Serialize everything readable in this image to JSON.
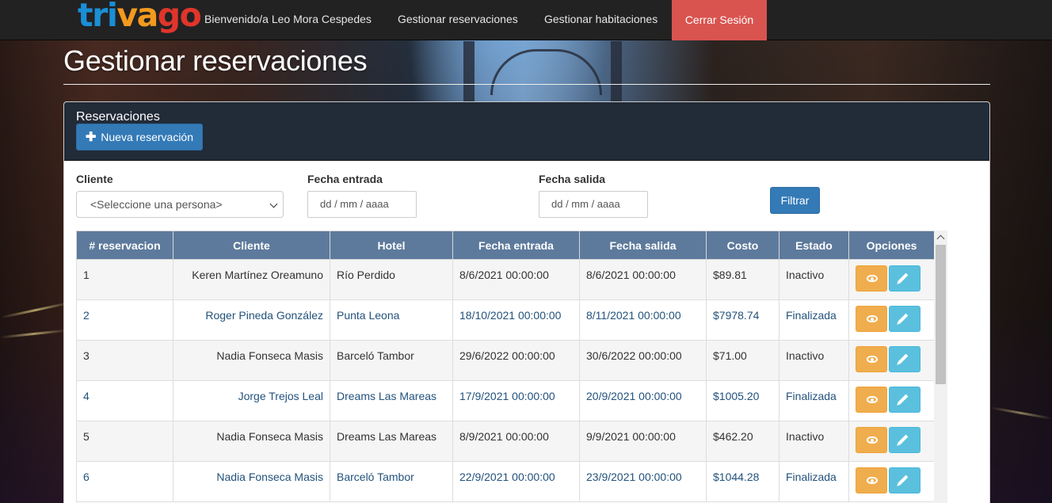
{
  "brand": {
    "part1": "tri",
    "part2": "va",
    "part3": "go"
  },
  "nav": {
    "welcome": "Bienvenido/a Leo Mora Cespedes",
    "manage_reservations": "Gestionar reservaciones",
    "manage_rooms": "Gestionar habitaciones",
    "logout": "Cerrar Sesión"
  },
  "page": {
    "title": "Gestionar reservaciones"
  },
  "panel": {
    "title": "Reservaciones",
    "new_button": "Nueva reservación"
  },
  "filters": {
    "client_label": "Cliente",
    "client_value": "<Seleccione una persona>",
    "checkin_label": "Fecha entrada",
    "checkin_placeholder": "dd / mm / aaaa",
    "checkout_label": "Fecha salida",
    "checkout_placeholder": "dd / mm / aaaa",
    "filter_button": "Filtrar"
  },
  "table": {
    "headers": [
      "# reservacion",
      "Cliente",
      "Hotel",
      "Fecha entrada",
      "Fecha salida",
      "Costo",
      "Estado",
      "Opciones"
    ],
    "rows": [
      {
        "id": "1",
        "client": "Keren Martínez Oreamuno",
        "hotel": "Río Perdido",
        "checkin": "8/6/2021 00:00:00",
        "checkout": "8/6/2021 00:00:00",
        "cost": "$89.81",
        "status": "Inactivo"
      },
      {
        "id": "2",
        "client": "Roger Pineda González",
        "hotel": "Punta Leona",
        "checkin": "18/10/2021 00:00:00",
        "checkout": "8/11/2021 00:00:00",
        "cost": "$7978.74",
        "status": "Finalizada"
      },
      {
        "id": "3",
        "client": "Nadia Fonseca Masis",
        "hotel": "Barceló Tambor",
        "checkin": "29/6/2022 00:00:00",
        "checkout": "30/6/2022 00:00:00",
        "cost": "$71.00",
        "status": "Inactivo"
      },
      {
        "id": "4",
        "client": "Jorge Trejos Leal",
        "hotel": "Dreams Las Mareas",
        "checkin": "17/9/2021 00:00:00",
        "checkout": "20/9/2021 00:00:00",
        "cost": "$1005.20",
        "status": "Finalizada"
      },
      {
        "id": "5",
        "client": "Nadia Fonseca Masis",
        "hotel": "Dreams Las Mareas",
        "checkin": "8/9/2021 00:00:00",
        "checkout": "9/9/2021 00:00:00",
        "cost": "$462.20",
        "status": "Inactivo"
      },
      {
        "id": "6",
        "client": "Nadia Fonseca Masis",
        "hotel": "Barceló Tambor",
        "checkin": "22/9/2021 00:00:00",
        "checkout": "23/9/2021 00:00:00",
        "cost": "$1044.28",
        "status": "Finalizada"
      }
    ]
  },
  "icons": {
    "new": "plus-icon",
    "view": "eye-icon",
    "edit": "pencil-icon"
  },
  "colors": {
    "header_bg": "#5d7a9c",
    "primary": "#337ab7",
    "danger": "#d9534f",
    "warning": "#f0ad4e",
    "info": "#5bc0de"
  }
}
